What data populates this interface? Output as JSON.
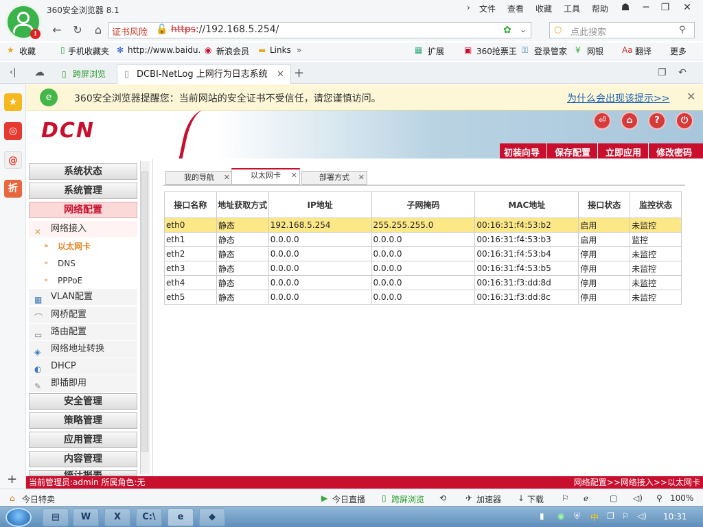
{
  "browser": {
    "app_title": "360安全浏览器 8.1",
    "menu": [
      "文件",
      "查看",
      "收藏",
      "工具",
      "帮助"
    ],
    "cert_warning": "证书风险",
    "url_scheme": "https",
    "url_rest": "://192.168.5.254/",
    "search_placeholder": "点此搜索",
    "bookmarks": [
      "收藏",
      "手机收藏夹",
      "http://www.baidu.",
      "新浪会员",
      "Links",
      "扩展",
      "360抢票王",
      "登录管家",
      "网银",
      "翻译",
      "更多"
    ],
    "tabs": [
      "跨屏浏览",
      "DCBI-NetLog 上网行为日志系统"
    ],
    "security_notice": "360安全浏览器提醒您：当前网站的安全证书不受信任，请您谨慎访问。",
    "security_link": "为什么会出现该提示>>",
    "status_left": "今日特卖",
    "status_items": [
      "今日直播",
      "跨屏浏览",
      "加速器",
      "下载"
    ],
    "zoom": "100%"
  },
  "app": {
    "brand": "DCN",
    "nav_links": [
      "初装向导",
      "保存配置",
      "立即应用",
      "修改密码"
    ],
    "menu_top": [
      "系统状态",
      "系统管理",
      "网络配置"
    ],
    "menu_section": "网络接入",
    "menu_leaves": [
      "以太网卡",
      "DNS",
      "PPPoE"
    ],
    "menu_subs": [
      "VLAN配置",
      "网桥配置",
      "路由配置",
      "网络地址转换",
      "DHCP",
      "即插即用"
    ],
    "menu_bottom": [
      "安全管理",
      "策略管理",
      "应用管理",
      "内容管理",
      "统计报表"
    ],
    "content_tabs": [
      "我的导航",
      "以太网卡",
      "部署方式"
    ],
    "table": {
      "headers": [
        "接口名称",
        "地址获取方式",
        "IP地址",
        "子网掩码",
        "MAC地址",
        "接口状态",
        "监控状态"
      ],
      "rows": [
        [
          "eth0",
          "静态",
          "192.168.5.254",
          "255.255.255.0",
          "00:16:31:f4:53:b2",
          "启用",
          "未监控"
        ],
        [
          "eth1",
          "静态",
          "0.0.0.0",
          "0.0.0.0",
          "00:16:31:f4:53:b3",
          "启用",
          "监控"
        ],
        [
          "eth2",
          "静态",
          "0.0.0.0",
          "0.0.0.0",
          "00:16:31:f4:53:b4",
          "停用",
          "未监控"
        ],
        [
          "eth3",
          "静态",
          "0.0.0.0",
          "0.0.0.0",
          "00:16:31:f4:53:b5",
          "停用",
          "未监控"
        ],
        [
          "eth4",
          "静态",
          "0.0.0.0",
          "0.0.0.0",
          "00:16:31:f3:dd:8d",
          "停用",
          "未监控"
        ],
        [
          "eth5",
          "静态",
          "0.0.0.0",
          "0.0.0.0",
          "00:16:31:f3:dd:8c",
          "停用",
          "未监控"
        ]
      ]
    },
    "footer_left": "当前管理员:admin 所属角色:无",
    "footer_right": "网络配置>>网络接入>>以太网卡"
  },
  "taskbar": {
    "clock": "10:31"
  },
  "colors": {
    "brand_red": "#c8102e",
    "selected_row": "#fde887"
  }
}
